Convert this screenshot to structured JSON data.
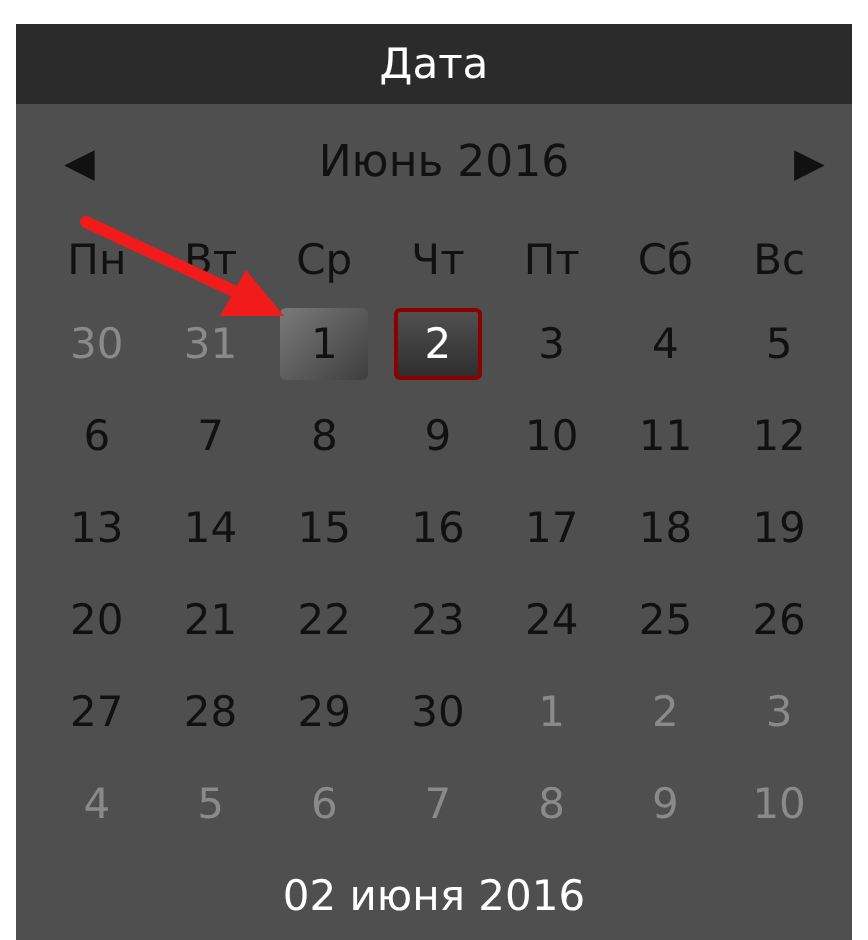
{
  "title": "Дата",
  "nav": {
    "prev": "◀",
    "month": "Июнь 2016",
    "next": "▶"
  },
  "weekdays": [
    "Пн",
    "Вт",
    "Ср",
    "Чт",
    "Пт",
    "Сб",
    "Вс"
  ],
  "days": [
    {
      "label": "30",
      "kind": "other",
      "selected": false,
      "hovered": false
    },
    {
      "label": "31",
      "kind": "other",
      "selected": false,
      "hovered": false
    },
    {
      "label": "1",
      "kind": "current",
      "selected": false,
      "hovered": true
    },
    {
      "label": "2",
      "kind": "current",
      "selected": true,
      "hovered": false
    },
    {
      "label": "3",
      "kind": "current",
      "selected": false,
      "hovered": false
    },
    {
      "label": "4",
      "kind": "current",
      "selected": false,
      "hovered": false
    },
    {
      "label": "5",
      "kind": "current",
      "selected": false,
      "hovered": false
    },
    {
      "label": "6",
      "kind": "current",
      "selected": false,
      "hovered": false
    },
    {
      "label": "7",
      "kind": "current",
      "selected": false,
      "hovered": false
    },
    {
      "label": "8",
      "kind": "current",
      "selected": false,
      "hovered": false
    },
    {
      "label": "9",
      "kind": "current",
      "selected": false,
      "hovered": false
    },
    {
      "label": "10",
      "kind": "current",
      "selected": false,
      "hovered": false
    },
    {
      "label": "11",
      "kind": "current",
      "selected": false,
      "hovered": false
    },
    {
      "label": "12",
      "kind": "current",
      "selected": false,
      "hovered": false
    },
    {
      "label": "13",
      "kind": "current",
      "selected": false,
      "hovered": false
    },
    {
      "label": "14",
      "kind": "current",
      "selected": false,
      "hovered": false
    },
    {
      "label": "15",
      "kind": "current",
      "selected": false,
      "hovered": false
    },
    {
      "label": "16",
      "kind": "current",
      "selected": false,
      "hovered": false
    },
    {
      "label": "17",
      "kind": "current",
      "selected": false,
      "hovered": false
    },
    {
      "label": "18",
      "kind": "current",
      "selected": false,
      "hovered": false
    },
    {
      "label": "19",
      "kind": "current",
      "selected": false,
      "hovered": false
    },
    {
      "label": "20",
      "kind": "current",
      "selected": false,
      "hovered": false
    },
    {
      "label": "21",
      "kind": "current",
      "selected": false,
      "hovered": false
    },
    {
      "label": "22",
      "kind": "current",
      "selected": false,
      "hovered": false
    },
    {
      "label": "23",
      "kind": "current",
      "selected": false,
      "hovered": false
    },
    {
      "label": "24",
      "kind": "current",
      "selected": false,
      "hovered": false
    },
    {
      "label": "25",
      "kind": "current",
      "selected": false,
      "hovered": false
    },
    {
      "label": "26",
      "kind": "current",
      "selected": false,
      "hovered": false
    },
    {
      "label": "27",
      "kind": "current",
      "selected": false,
      "hovered": false
    },
    {
      "label": "28",
      "kind": "current",
      "selected": false,
      "hovered": false
    },
    {
      "label": "29",
      "kind": "current",
      "selected": false,
      "hovered": false
    },
    {
      "label": "30",
      "kind": "current",
      "selected": false,
      "hovered": false
    },
    {
      "label": "1",
      "kind": "other",
      "selected": false,
      "hovered": false
    },
    {
      "label": "2",
      "kind": "other",
      "selected": false,
      "hovered": false
    },
    {
      "label": "3",
      "kind": "other",
      "selected": false,
      "hovered": false
    },
    {
      "label": "4",
      "kind": "other",
      "selected": false,
      "hovered": false
    },
    {
      "label": "5",
      "kind": "other",
      "selected": false,
      "hovered": false
    },
    {
      "label": "6",
      "kind": "other",
      "selected": false,
      "hovered": false
    },
    {
      "label": "7",
      "kind": "other",
      "selected": false,
      "hovered": false
    },
    {
      "label": "8",
      "kind": "other",
      "selected": false,
      "hovered": false
    },
    {
      "label": "9",
      "kind": "other",
      "selected": false,
      "hovered": false
    },
    {
      "label": "10",
      "kind": "other",
      "selected": false,
      "hovered": false
    }
  ],
  "footer": "02 июня 2016"
}
